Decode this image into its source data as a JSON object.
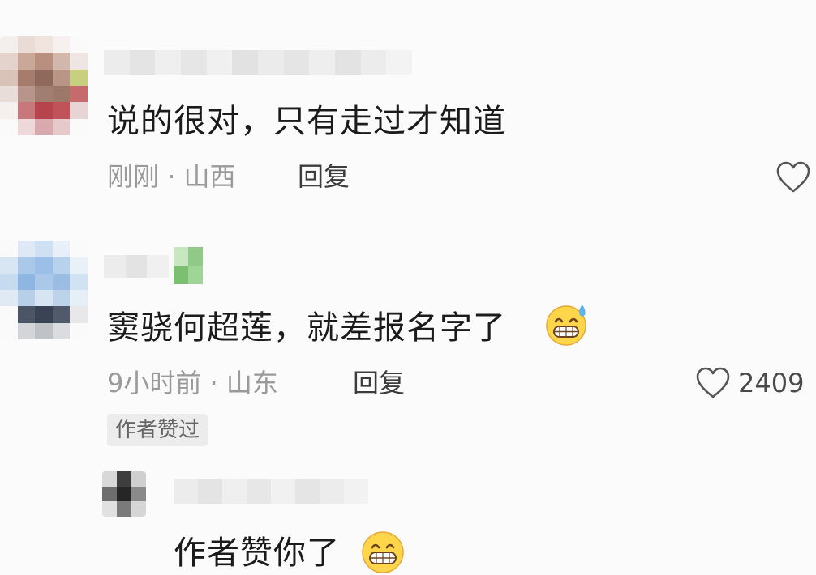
{
  "comments": [
    {
      "text": "说的很对，只有走过才知道",
      "time": "刚刚",
      "location": "山西",
      "reply_label": "回复",
      "likes": null
    },
    {
      "text": "窦骁何超莲，就差报名字了",
      "time": "9小时前",
      "location": "山东",
      "reply_label": "回复",
      "likes": "2409",
      "badge": "作者赞过",
      "emoji": "grinning-sweat"
    }
  ],
  "sub_reply": {
    "text": "作者赞你了",
    "emoji": "grinning"
  },
  "separator": "·",
  "colors": {
    "background": "#fbfbfb",
    "text": "#1b1b1b",
    "meta": "#9a9a9a",
    "badge_bg": "#ececec"
  },
  "icons": [
    "heart-outline-icon",
    "emoji-grin-sweat",
    "emoji-grin"
  ]
}
